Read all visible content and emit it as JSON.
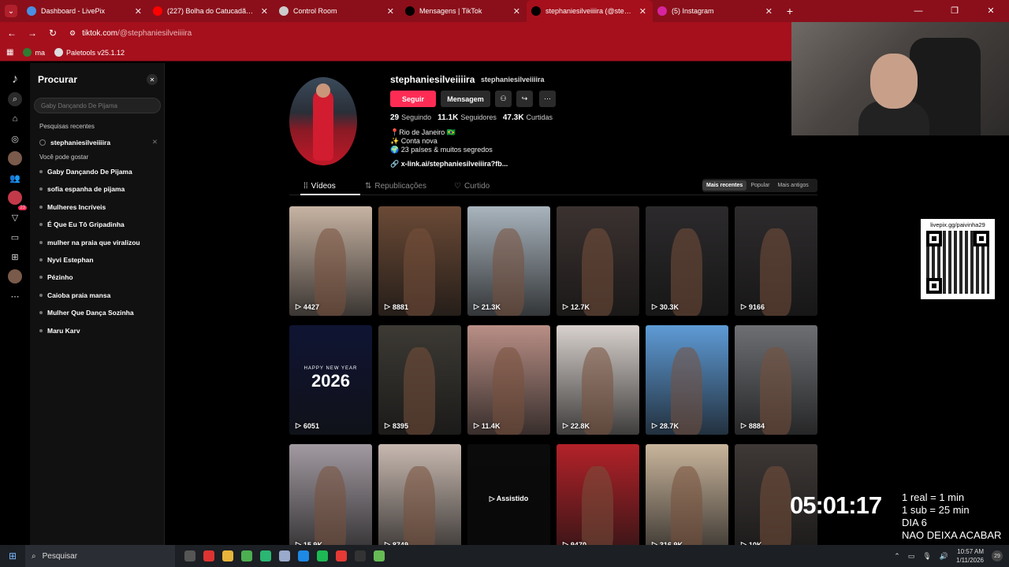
{
  "browser": {
    "tabs": [
      {
        "title": "Dashboard - LivePix",
        "icon": "livepix-icon",
        "color": "#4a90e2"
      },
      {
        "title": "(227) Bolha do Catucadão - Eu",
        "icon": "youtube-icon",
        "color": "#ff0000"
      },
      {
        "title": "Control Room",
        "icon": "control-room-icon",
        "color": "#cccccc"
      },
      {
        "title": "Mensagens | TikTok",
        "icon": "tiktok-icon",
        "color": "#000000"
      },
      {
        "title": "stephaniesilveiiiira (@stephanie",
        "icon": "tiktok-icon",
        "color": "#000000"
      },
      {
        "title": "(5) Instagram",
        "icon": "instagram-icon",
        "color": "#d6249f"
      }
    ],
    "url_domain": "tiktok.com",
    "url_path": "/@stephaniesilveiiiira",
    "bookmarks": [
      {
        "label": "ma"
      },
      {
        "label": "Paletools v25.1.12"
      }
    ]
  },
  "sidebar": {
    "title": "Procurar",
    "search_placeholder": "Gaby Dançando De Pijama",
    "recent_header": "Pesquisas recentes",
    "recent": [
      "stephaniesilveiiiira"
    ],
    "suggest_header": "Você pode gostar",
    "suggestions": [
      "Gaby Dançando De Pijama",
      "sofia espanha de pijama",
      "Mulheres Incríveis",
      "É Que Eu Tô Gripadinha",
      "mulher na praia que viralizou",
      "Nyvi Estephan",
      "Pézinho",
      "Caioba praia mansa",
      "Mulher Que Dança Sozinha",
      "Maru Karv"
    ],
    "rail_badge": "23"
  },
  "profile": {
    "name": "stephaniesilveiiiira",
    "handle": "stephaniesilveiiiira",
    "follow_label": "Seguir",
    "message_label": "Mensagem",
    "following_count": "29",
    "following_label": "Seguindo",
    "followers_count": "11.1K",
    "followers_label": "Seguidores",
    "likes_count": "47.3K",
    "likes_label": "Curtidas",
    "bio": [
      "📍Rio de Janeiro 🇧🇷",
      "✨ Conta nova",
      "🌍 23 países & muitos segredos"
    ],
    "link": "x-link.ai/stephaniesilveiiira?fb..."
  },
  "content_tabs": {
    "videos": "Vídeos",
    "reposts": "Republicações",
    "liked": "Curtido"
  },
  "sort": {
    "recent": "Mais recentes",
    "popular": "Popular",
    "oldest": "Mais antigos"
  },
  "videos": [
    {
      "views": "4427",
      "color": "#c7b3a3"
    },
    {
      "views": "8881",
      "color": "#6b4a36"
    },
    {
      "views": "21.3K",
      "color": "#a9b4bd"
    },
    {
      "views": "12.7K",
      "color": "#3b3230"
    },
    {
      "views": "30.3K",
      "color": "#2c2a2c"
    },
    {
      "views": "9166",
      "color": "#2e2b2d"
    },
    {
      "views": "6051",
      "color": "#0f1433",
      "ny_small": "HAPPY NEW YEAR",
      "ny_big": "2026"
    },
    {
      "views": "8395",
      "color": "#3d3a34"
    },
    {
      "views": "11.4K",
      "color": "#b98f86"
    },
    {
      "views": "22.8K",
      "color": "#d8d1cd"
    },
    {
      "views": "28.7K",
      "color": "#5e9bd6"
    },
    {
      "views": "8884",
      "color": "#6d6f73"
    },
    {
      "views": "15.9K",
      "color": "#a29aa1"
    },
    {
      "views": "8749",
      "color": "#c8b9b0"
    },
    {
      "views": "",
      "color": "#1a1a1c",
      "overlay": "▷ Assistido"
    },
    {
      "views": "9470",
      "color": "#b32229"
    },
    {
      "views": "316.9K",
      "color": "#c9b59c"
    },
    {
      "views": "10K",
      "color": "#3e3836"
    }
  ],
  "qr_label": "livepix.gg/paivinha29",
  "overlay": {
    "timer": "05:01:17",
    "lines": [
      "1 real = 1 min",
      "1 sub = 25 min",
      "DIA 6",
      "NAO DEIXA ACABAR"
    ]
  },
  "taskbar": {
    "search_label": "Pesquisar",
    "time": "10:57 AM",
    "date": "1/11/2026",
    "badge": "29"
  }
}
